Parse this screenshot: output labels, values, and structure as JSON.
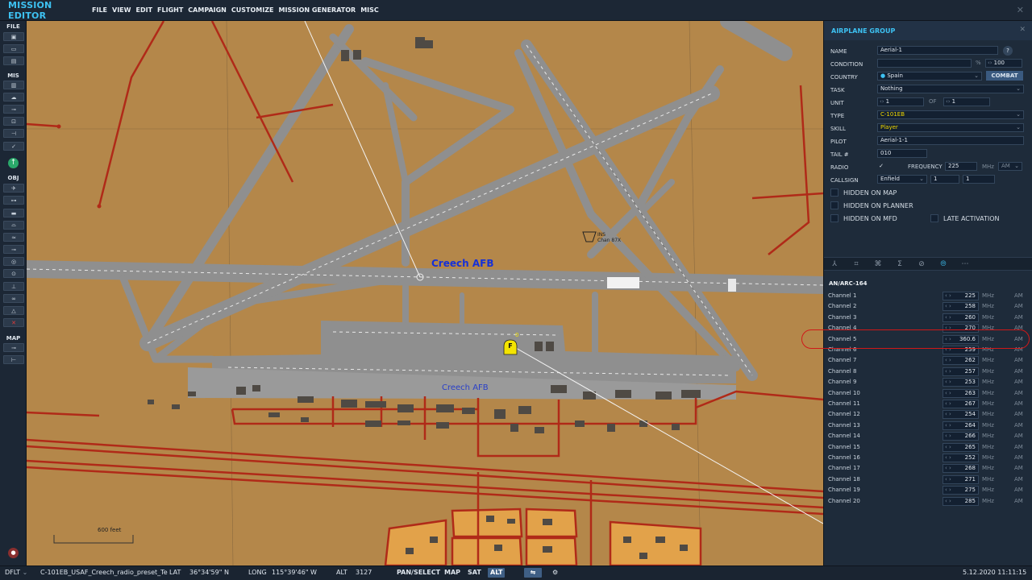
{
  "app": {
    "title": "MISSION EDITOR",
    "menu": [
      "FILE",
      "VIEW",
      "EDIT",
      "FLIGHT",
      "CAMPAIGN",
      "CUSTOMIZE",
      "MISSION GENERATOR",
      "MISC"
    ],
    "close_glyph": "✕"
  },
  "toolbar": {
    "file_label": "FILE",
    "mis_label": "MIS",
    "obj_label": "OBJ",
    "map_label": "MAP"
  },
  "map": {
    "airfield_label": "Creech AFB",
    "airfield_label_small": "Creech AFB",
    "ins_label_1": "INS",
    "ins_label_2": "Chan 87X",
    "scale_label": "600 feet",
    "group_marker_letter": "F",
    "group_marker_index": "0",
    "colors": {
      "terrain": "#b4874a",
      "roads": "#b02a18",
      "taxi": "#8f8f8f",
      "buildings": "#4f4a44",
      "town": "#e2a24a"
    }
  },
  "panel": {
    "title": "AIRPLANE GROUP",
    "fields": {
      "name": {
        "label": "NAME",
        "value": "Aerial-1"
      },
      "condition": {
        "label": "CONDITION",
        "value": "",
        "percent_unit": "%",
        "percent": "100"
      },
      "country": {
        "label": "COUNTRY",
        "value": "Spain",
        "combat": "COMBAT"
      },
      "task": {
        "label": "TASK",
        "value": "Nothing"
      },
      "unit": {
        "label": "UNIT",
        "value": "1",
        "of_label": "OF",
        "of_value": "1"
      },
      "type": {
        "label": "TYPE",
        "value": "C-101EB"
      },
      "skill": {
        "label": "SKILL",
        "value": "Player"
      },
      "pilot": {
        "label": "PILOT",
        "value": "Aerial-1-1"
      },
      "tail": {
        "label": "TAIL #",
        "value": "010"
      },
      "radio": {
        "label": "RADIO",
        "checked": "✓",
        "freq_label": "FREQUENCY",
        "freq_value": "225",
        "freq_unit": "MHz",
        "modulation": "AM"
      },
      "callsign": {
        "label": "CALLSIGN",
        "value": "Enfield",
        "num1": "1",
        "num2": "1"
      }
    },
    "checkboxes": {
      "hidden_on_map": "HIDDEN ON MAP",
      "hidden_on_planner": "HIDDEN ON PLANNER",
      "hidden_on_mfd": "HIDDEN ON MFD",
      "late_activation": "LATE ACTIVATION"
    },
    "tabs": [
      "route-icon",
      "payload-icon",
      "summary-icon",
      "sigma-icon",
      "failures-icon",
      "radio-icon",
      "more-icon"
    ],
    "tab_glyphs": [
      "⅄",
      "⌗",
      "⌘",
      "Σ",
      "⊘",
      "⦾",
      "⋯"
    ],
    "radio_name": "AN/ARC-164",
    "unit_mhz": "MHz",
    "modulation": "AM",
    "channels": [
      {
        "label": "Channel 1",
        "value": "225"
      },
      {
        "label": "Channel 2",
        "value": "258"
      },
      {
        "label": "Channel 3",
        "value": "260"
      },
      {
        "label": "Channel 4",
        "value": "270"
      },
      {
        "label": "Channel 5",
        "value": "360.6"
      },
      {
        "label": "Channel 6",
        "value": "259"
      },
      {
        "label": "Channel 7",
        "value": "262"
      },
      {
        "label": "Channel 8",
        "value": "257"
      },
      {
        "label": "Channel 9",
        "value": "253"
      },
      {
        "label": "Channel 10",
        "value": "263"
      },
      {
        "label": "Channel 11",
        "value": "267"
      },
      {
        "label": "Channel 12",
        "value": "254"
      },
      {
        "label": "Channel 13",
        "value": "264"
      },
      {
        "label": "Channel 14",
        "value": "266"
      },
      {
        "label": "Channel 15",
        "value": "265"
      },
      {
        "label": "Channel 16",
        "value": "252"
      },
      {
        "label": "Channel 17",
        "value": "268"
      },
      {
        "label": "Channel 18",
        "value": "271"
      },
      {
        "label": "Channel 19",
        "value": "275"
      },
      {
        "label": "Channel 20",
        "value": "285"
      }
    ]
  },
  "status": {
    "profile": "DFLT",
    "filename": "C-101EB_USAF_Creech_radio_preset_Te",
    "lat_label": "LAT",
    "lat_value": "36°34'59\" N",
    "long_label": "LONG",
    "long_value": "115°39'46\" W",
    "alt_label": "ALT",
    "alt_value": "3127",
    "pan_select": "PAN/SELECT",
    "map_btn": "MAP",
    "sat_btn": "SAT",
    "alt_btn": "ALT",
    "datetime": "5.12.2020 11:11:15"
  }
}
